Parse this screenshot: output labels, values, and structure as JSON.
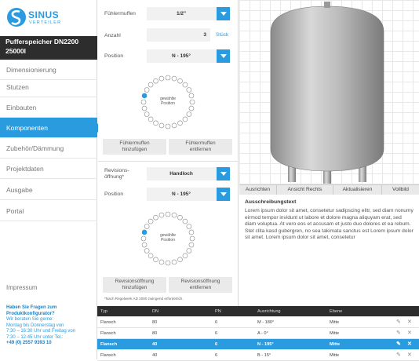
{
  "brand": {
    "name": "SINUS",
    "sub": "VERTEILER"
  },
  "product": {
    "line1": "Pufferspeicher DN2200",
    "line2": "25000l"
  },
  "nav": [
    {
      "label": "Dimensionierung",
      "active": false
    },
    {
      "label": "Stutzen",
      "active": false
    },
    {
      "label": "Einbauten",
      "active": false
    },
    {
      "label": "Komponenten",
      "active": true
    },
    {
      "label": "Zubehör/Dämmung",
      "active": false
    },
    {
      "label": "Projektdaten",
      "active": false
    },
    {
      "label": "Ausgabe",
      "active": false
    },
    {
      "label": "Portal",
      "active": false
    }
  ],
  "impressum": "Impressum",
  "contact": {
    "q1": "Haben Sie Fragen zum",
    "q2": "Produktkonfigurator?",
    "l1": "Wir beraten Sie gerne:",
    "l2": "Montag bis Donnerstag von",
    "l3": "7:30 – 16:30 Uhr und Freitag von",
    "l4": "7:30 – 12:45 Uhr unter Tel.:",
    "phone": "+49 (0) 2557 9393 10"
  },
  "section1": {
    "muffen_label": "Fühlermuffen",
    "muffen_value": "1/2\"",
    "anzahl_label": "Anzahl",
    "anzahl_value": "3",
    "anzahl_unit": "Stück",
    "position_label": "Position",
    "position_value": "N - 195°",
    "circle_text1": "gewählte",
    "circle_text2": "Position",
    "add_btn1": "Fühlermuffen",
    "add_btn2": "hinzufügen",
    "rem_btn1": "Fühlermuffen",
    "rem_btn2": "entfernen"
  },
  "section2": {
    "rev_label1": "Revisions-",
    "rev_label2": "öffnung*",
    "rev_value": "Handloch",
    "position_label": "Position",
    "position_value": "N - 195°",
    "circle_text1": "gewählte",
    "circle_text2": "Position",
    "add_btn1": "Revisionsöffnung",
    "add_btn2": "hinzufügen",
    "rem_btn1": "Revisionsöffnung",
    "rem_btn2": "entfernen",
    "footnote": "*Nach Regelwerk AD 2000 zwingend erforderlich."
  },
  "viewbar": [
    "Ausrichten",
    "Ansicht Rechts",
    "Aktualisieren",
    "Vollbild"
  ],
  "description": {
    "title": "Ausschreibungstext",
    "text": "Lorem ipsum dolor sit amet, consetetur sadipscing elitr, sed diam nonumy eirmod tempor invidunt ut labore et dolore magna aliquyam erat, sed diam voluptua. At vero eos et accusam et justo duo dolores et ea rebum. Stet clita kasd gubergren, no sea takimata sanctus est Lorem ipsum dolor sit amet. Lorem ipsum dolor sit amet, consetetur"
  },
  "table": {
    "headers": [
      "Typ",
      "DN",
      "PN",
      "Ausrichtung",
      "Ebene"
    ],
    "rows": [
      [
        "Flansch",
        "80",
        "6",
        "M - 180°",
        "Mitte"
      ],
      [
        "Flansch",
        "80",
        "6",
        "A - 0°",
        "Mitte"
      ],
      [
        "Flansch",
        "40",
        "6",
        "N - 195°",
        "Mitte"
      ],
      [
        "Flansch",
        "40",
        "6",
        "B - 15°",
        "Mitte"
      ]
    ],
    "selected_row": 2
  },
  "colors": {
    "accent": "#2a9bdf",
    "dark": "#2d2d2d"
  }
}
